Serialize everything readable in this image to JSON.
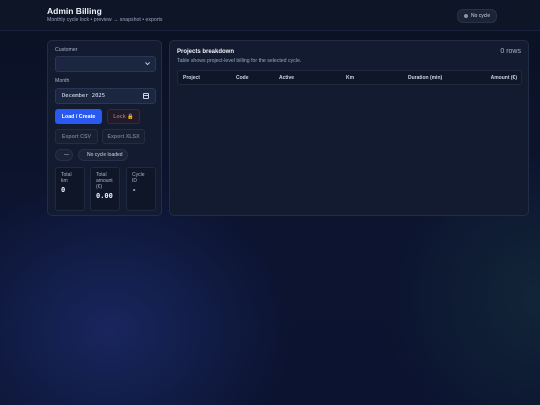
{
  "header": {
    "title": "Admin Billing",
    "subtitle": "Monthly cycle lock • preview → snapshot • exports",
    "status": "No cycle"
  },
  "left_panel": {
    "customer_label": "Customer",
    "customer_value": "",
    "month_label": "Month",
    "month_value": "December 2025",
    "load_button": "Load / Create",
    "lock_button": "Lock 🔒",
    "export_csv": "Export CSV",
    "export_xlsx": "Export XLSX",
    "state_pill": "—",
    "cycle_pill": "No cycle loaded",
    "stats": [
      {
        "label": "Total km",
        "value": "0"
      },
      {
        "label": "Total amount (€)",
        "value": "0.00"
      },
      {
        "label": "Cycle ID",
        "value": "-"
      }
    ]
  },
  "table": {
    "title": "Projects breakdown",
    "subtitle": "Table shows project-level billing for the selected cycle.",
    "rows_count": "0 rows",
    "columns": [
      "Project",
      "Code",
      "Active",
      "Km",
      "Duration (min)",
      "Amount (€)"
    ],
    "rows": []
  },
  "colors": {
    "primary": "#2a59f2",
    "background": "#0b1224",
    "card": "#121b2f"
  }
}
